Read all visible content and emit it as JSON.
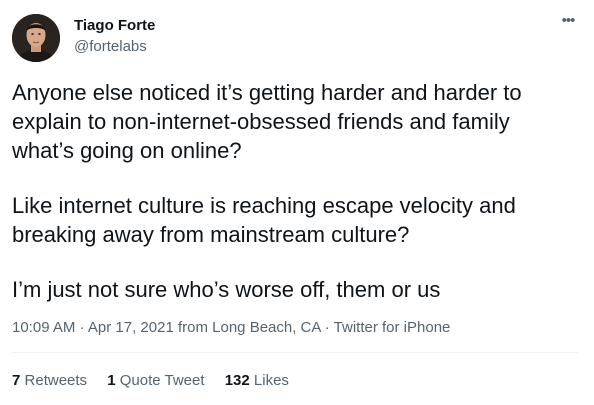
{
  "author": {
    "display_name": "Tiago Forte",
    "handle": "@fortelabs"
  },
  "more_icon": "more-horizontal-icon",
  "tweet": {
    "paragraphs": [
      "Anyone else noticed it’s getting harder and harder to\nexplain to non-internet-obsessed friends and family\nwhat’s going on online?",
      "Like internet culture is reaching escape velocity and\nbreaking away from mainstream culture?",
      "I’m just not sure who’s worse off, them or us"
    ]
  },
  "meta": {
    "time": "10:09 AM",
    "separator": "·",
    "date": "Apr 17, 2021",
    "from": "from",
    "location": "Long Beach, CA",
    "source": "Twitter for iPhone"
  },
  "stats": {
    "retweets_count": "7",
    "retweets_label": "Retweets",
    "quotes_count": "1",
    "quotes_label": "Quote Tweet",
    "likes_count": "132",
    "likes_label": "Likes"
  },
  "colors": {
    "text": "#0f1419",
    "secondary": "#536471",
    "divider": "#eff3f4"
  }
}
